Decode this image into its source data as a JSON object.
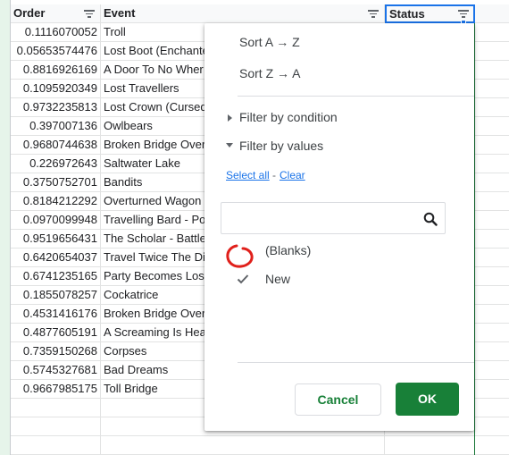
{
  "sheet": {
    "headers": {
      "order": "Order",
      "event": "Event",
      "status": "Status"
    },
    "rows": [
      {
        "order": "0.1116070052",
        "event": "Troll"
      },
      {
        "order": "0.05653574476",
        "event": "Lost Boot (Enchante"
      },
      {
        "order": "0.8816926169",
        "event": "A Door To No Wher"
      },
      {
        "order": "0.1095920349",
        "event": "Lost Travellers"
      },
      {
        "order": "0.9732235813",
        "event": "Lost Crown (Cursed"
      },
      {
        "order": "0.397007136",
        "event": "Owlbears"
      },
      {
        "order": "0.9680744638",
        "event": "Broken Bridge Over"
      },
      {
        "order": "0.226972643",
        "event": "Saltwater Lake"
      },
      {
        "order": "0.3750752701",
        "event": "Bandits"
      },
      {
        "order": "0.8184212292",
        "event": "Overturned Wagon"
      },
      {
        "order": "0.0970099948",
        "event": "Travelling Bard - Po"
      },
      {
        "order": "0.9519656431",
        "event": "The Scholar - Battle"
      },
      {
        "order": "0.6420654037",
        "event": "Travel Twice The Di"
      },
      {
        "order": "0.6741235165",
        "event": "Party Becomes Los"
      },
      {
        "order": "0.1855078257",
        "event": "Cockatrice"
      },
      {
        "order": "0.4531416176",
        "event": "Broken Bridge Over"
      },
      {
        "order": "0.4877605191",
        "event": "A Screaming Is Hea"
      },
      {
        "order": "0.7359150268",
        "event": "Corpses"
      },
      {
        "order": "0.5745327681",
        "event": "Bad Dreams"
      },
      {
        "order": "0.9667985175",
        "event": "Toll Bridge"
      }
    ]
  },
  "filter_menu": {
    "sort_az": "Sort A → Z",
    "sort_za": "Sort Z → A",
    "by_condition": "Filter by condition",
    "by_values": "Filter by values",
    "select_all": "Select all",
    "separator": "-",
    "clear": "Clear",
    "search_value": "",
    "values": [
      {
        "label": "(Blanks)",
        "checked": false
      },
      {
        "label": "New",
        "checked": true
      }
    ],
    "cancel": "Cancel",
    "ok": "OK"
  },
  "colors": {
    "accent_blue": "#1a73e8",
    "ok_green": "#188038",
    "annotation_red": "#e0201b"
  },
  "icons": [
    "filter-icon",
    "search-icon",
    "check-icon",
    "triangle-right-icon",
    "triangle-down-icon"
  ]
}
